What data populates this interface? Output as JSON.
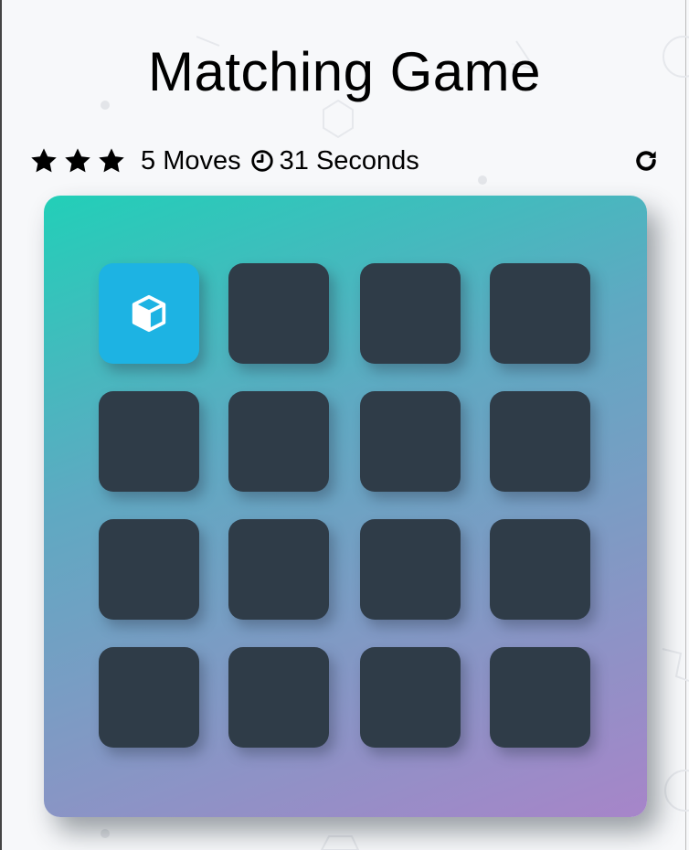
{
  "title": "Matching Game",
  "score": {
    "stars": [
      "star-1",
      "star-2",
      "star-3"
    ],
    "moves_count": "5",
    "moves_word": " Moves",
    "seconds_count": "31",
    "seconds_word": " Seconds"
  },
  "colors": {
    "card_back": "#2f3c48",
    "card_open": "#1db3e3",
    "gradient_start": "#22cfb8",
    "gradient_end": "#a785c9"
  },
  "deck": {
    "cards": [
      {
        "state": "open",
        "icon": "cube-icon"
      },
      {
        "state": "closed"
      },
      {
        "state": "closed"
      },
      {
        "state": "closed"
      },
      {
        "state": "closed"
      },
      {
        "state": "closed"
      },
      {
        "state": "closed"
      },
      {
        "state": "closed"
      },
      {
        "state": "closed"
      },
      {
        "state": "closed"
      },
      {
        "state": "closed"
      },
      {
        "state": "closed"
      },
      {
        "state": "closed"
      },
      {
        "state": "closed"
      },
      {
        "state": "closed"
      },
      {
        "state": "closed"
      }
    ]
  }
}
